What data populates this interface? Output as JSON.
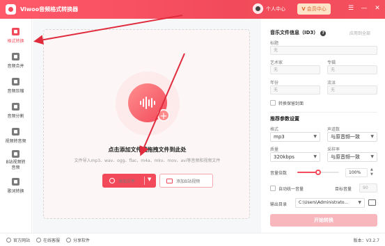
{
  "app": {
    "title": "Viwoo音频格式转换器"
  },
  "header": {
    "user_label": "个人中心",
    "vip_label": "会员中心",
    "vip_icon": "V"
  },
  "window_controls": {
    "menu": "☰",
    "minimize": "—",
    "close": "✕"
  },
  "sidebar": {
    "items": [
      {
        "label": "格式转换",
        "active": true
      },
      {
        "label": "音频合并"
      },
      {
        "label": "音频压缩"
      },
      {
        "label": "音频分割"
      },
      {
        "label": "视频转音频"
      },
      {
        "label": "B站视频转音频"
      },
      {
        "label": "歌词转换"
      }
    ]
  },
  "dropzone": {
    "title": "点击添加文件或拖拽文件到此处",
    "subtitle": "文件导入mp3、wav、ogg、flac、m4a、mkv、mov、avi等音频和视频文件",
    "add_button": "添加文件",
    "add_video_button": "添加B站视频"
  },
  "info": {
    "title": "音乐文件信息（ID3）",
    "help_icon": "?",
    "apply_all": "应用到全部",
    "fields": {
      "title": {
        "label": "标题",
        "placeholder": "无"
      },
      "artist": {
        "label": "艺术家",
        "placeholder": "无"
      },
      "album": {
        "label": "专辑",
        "placeholder": "无"
      },
      "year": {
        "label": "年份",
        "placeholder": "无"
      },
      "genre": {
        "label": "流派",
        "placeholder": "无"
      }
    },
    "keep_cover": "转换保留封面"
  },
  "params": {
    "title": "推荐参数设置",
    "format": {
      "label": "格式",
      "value": "mp3"
    },
    "channels": {
      "label": "声道数",
      "value": "与原音频一致"
    },
    "quality": {
      "label": "质量",
      "value": "320kbps"
    },
    "samplerate": {
      "label": "采样率",
      "value": "与原音频一致"
    },
    "volume": {
      "label": "音量倍数",
      "value": "100%",
      "fraction": 0.5
    },
    "auto_volume": "自动统一音量",
    "target_volume": {
      "label": "目标音量",
      "value": "90"
    },
    "output": {
      "label": "输出目录",
      "value": "C:\\Users\\Administrato..."
    },
    "start_button": "开始转换"
  },
  "footer": {
    "website": "官方网站",
    "service": "在线客服",
    "share": "分享软件",
    "version": "版本：V3.2.7"
  },
  "colors": {
    "accent": "#f24a5a",
    "vip": "#d9692e"
  }
}
